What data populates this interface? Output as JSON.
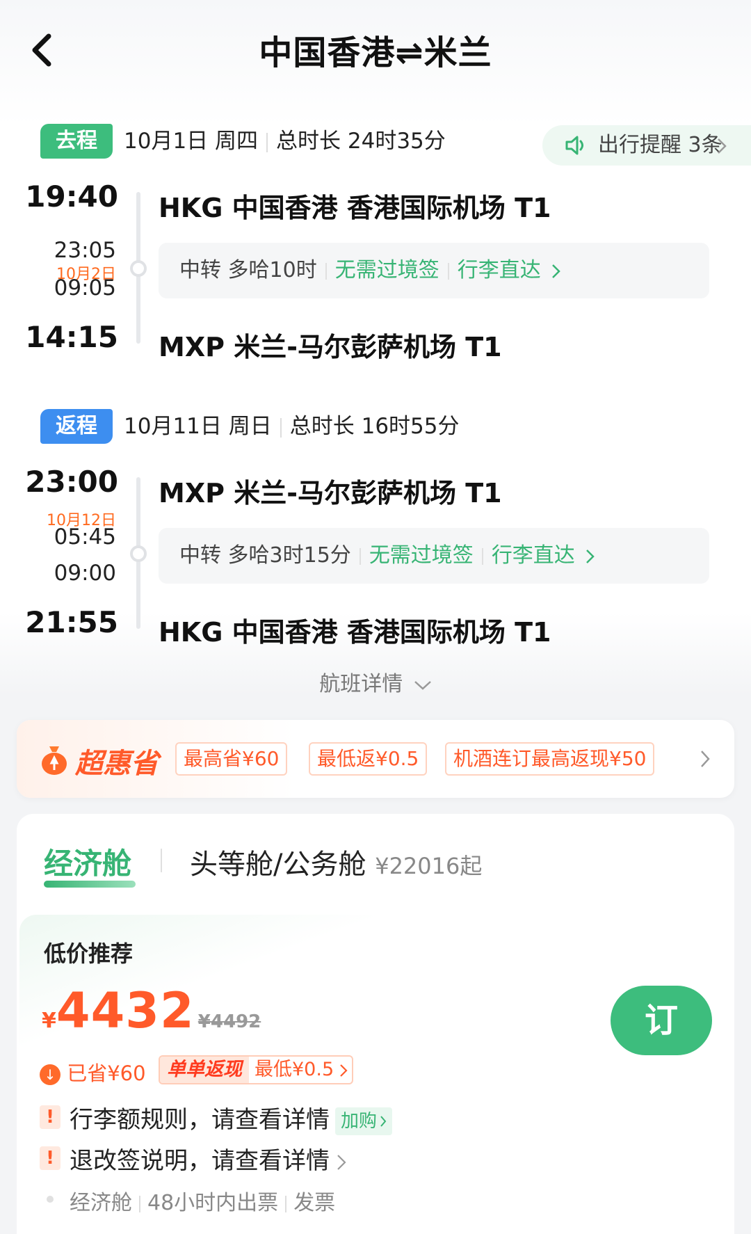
{
  "header": {
    "title": "中国香港⇌米兰"
  },
  "outbound": {
    "tag": "去程",
    "date": "10月1日 周四",
    "duration": "总时长 24时35分",
    "reminder": "出行提醒 3条",
    "depart_time": "19:40",
    "depart_airport": "HKG 中国香港 香港国际机场 T1",
    "transfer_arrive": "23:05",
    "transfer_date": "10月2日",
    "transfer_depart": "09:05",
    "transfer_label": "中转",
    "transfer_city": "多哈10时",
    "no_visa": "无需过境签",
    "baggage": "行李直达",
    "arrive_time": "14:15",
    "arrive_airport": "MXP 米兰-马尔彭萨机场 T1"
  },
  "inbound": {
    "tag": "返程",
    "date": "10月11日 周日",
    "duration": "总时长 16时55分",
    "depart_time": "23:00",
    "depart_airport": "MXP 米兰-马尔彭萨机场 T1",
    "transfer_date": "10月12日",
    "transfer_arrive": "05:45",
    "transfer_depart": "09:00",
    "transfer_label": "中转",
    "transfer_city": "多哈3时15分",
    "no_visa": "无需过境签",
    "baggage": "行李直达",
    "arrive_time": "21:55",
    "arrive_airport": "HKG 中国香港 香港国际机场 T1"
  },
  "flight_details": "航班详情",
  "promo": {
    "title": "超惠省",
    "chips": [
      "最高省¥60",
      "最低返¥0.5",
      "机酒连订最高返现¥50"
    ]
  },
  "cabins": {
    "economy": "经济舱",
    "first": "头等舱/公务舱",
    "first_price": "¥22016起"
  },
  "fare": {
    "label": "低价推荐",
    "currency": "¥",
    "price": "4432",
    "original": "¥4492",
    "book": "订",
    "saved": "已省¥60",
    "cashback_label": "单单返现",
    "cashback_value": "最低¥0.5",
    "rule1": "行李额规则，请查看详情",
    "add_buy": "加购",
    "rule2": "退改签说明，请查看详情",
    "footer": [
      "经济舱",
      "48小时内出票",
      "发票"
    ]
  },
  "colors": {
    "green": "#3dbd7d",
    "blue": "#3d8ef0",
    "orange": "#ff5a2a"
  }
}
